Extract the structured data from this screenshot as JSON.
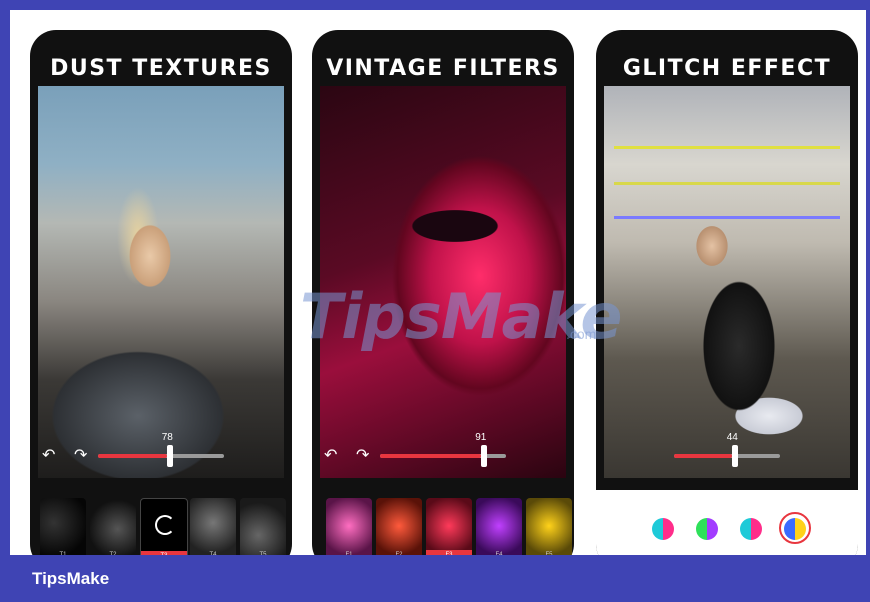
{
  "phones": [
    {
      "title": "DUST TEXTURES",
      "slider_value": "78",
      "slider_level": 0.55,
      "thumbnails": [
        "T1",
        "T2",
        "T3",
        "T4",
        "T5"
      ],
      "selected": 2
    },
    {
      "title": "VINTAGE FILTERS",
      "slider_value": "91",
      "slider_level": 0.8,
      "thumbnails": [
        "F1",
        "F2",
        "F3",
        "F4",
        "F5"
      ],
      "selected": 2
    },
    {
      "title": "GLITCH EFFECT",
      "slider_value": "44",
      "slider_level": 0.55,
      "color_options": [
        "#ff2d8a",
        "#a23cff",
        "#ff2d8a",
        "#3a6bff"
      ],
      "selected": 3
    }
  ],
  "watermark": {
    "main": "TipsMake",
    "suffix": ".com"
  },
  "footer": {
    "brand": "TipsMake"
  },
  "colors": {
    "accent": "#e8363f",
    "frame": "#3f44b4"
  }
}
